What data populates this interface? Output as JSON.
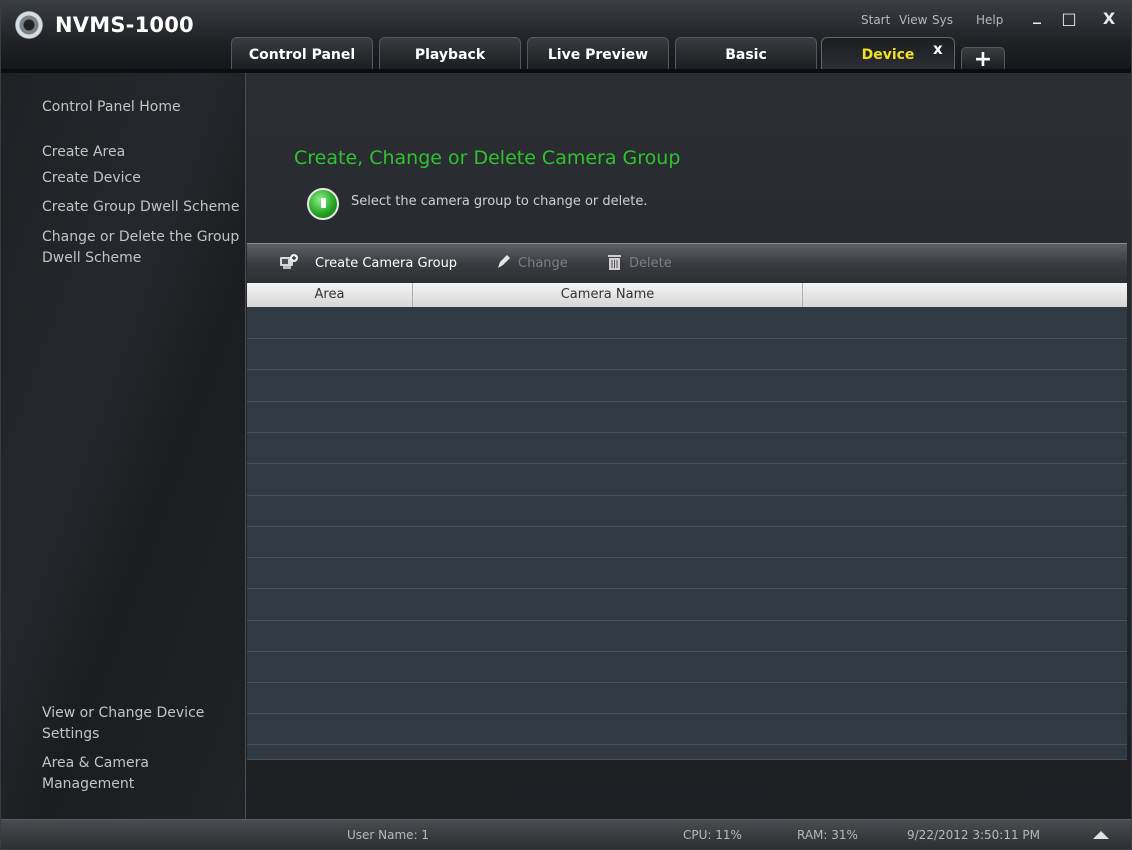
{
  "app": {
    "title": "NVMS-1000"
  },
  "menu": {
    "start": "Start",
    "view": "View",
    "sys": "Sys",
    "help": "Help"
  },
  "window": {
    "minimize": "_",
    "maximize": "□",
    "close": "X"
  },
  "tabs": [
    {
      "label": "Control Panel"
    },
    {
      "label": "Playback"
    },
    {
      "label": "Live Preview"
    },
    {
      "label": "Basic"
    },
    {
      "label": "Device",
      "active": true
    }
  ],
  "tab_close": "x",
  "tab_add": "+",
  "sidebar": {
    "home": "Control Panel Home",
    "items": [
      "Create Area",
      "Create Device",
      "Create Group Dwell Scheme",
      "Change or Delete the Group",
      "Dwell Scheme"
    ],
    "bottom": [
      "View or Change Device",
      "Settings",
      "Area & Camera Management"
    ]
  },
  "main": {
    "title": "Create, Change or Delete Camera Group",
    "hint": "Select the camera group to change or delete."
  },
  "toolbar": {
    "create": "Create Camera Group",
    "change": "Change",
    "delete": "Delete"
  },
  "grid": {
    "columns": [
      "Area",
      "Camera Name",
      ""
    ]
  },
  "status": {
    "user": "User Name: 1",
    "cpu": "CPU: 11%",
    "ram": "RAM: 31%",
    "datetime": "9/22/2012 3:50:11 PM"
  },
  "colors": {
    "accent_title": "#2fc22f",
    "active_tab": "#f0e020"
  }
}
